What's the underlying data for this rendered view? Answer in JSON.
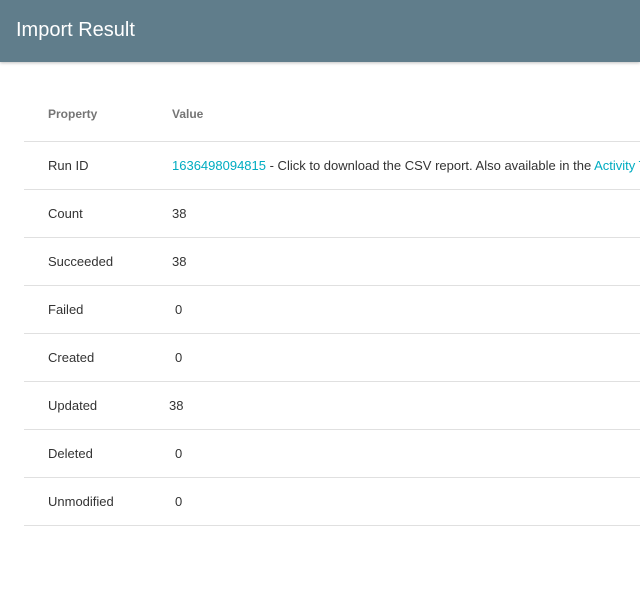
{
  "header": {
    "title": "Import Result"
  },
  "table": {
    "columns": {
      "property": "Property",
      "value": "Value"
    },
    "run": {
      "label": "Run ID",
      "id_link": "1636498094815",
      "description": " - Click to download the CSV report. Also available in the ",
      "activity_link": "Activity T"
    },
    "rows": [
      {
        "property": "Count",
        "value": "38"
      },
      {
        "property": "Succeeded",
        "value": "38"
      },
      {
        "property": "Failed",
        "value": "0"
      },
      {
        "property": "Created",
        "value": "0"
      },
      {
        "property": "Updated",
        "value": "38"
      },
      {
        "property": "Deleted",
        "value": "0"
      },
      {
        "property": "Unmodified",
        "value": "0"
      }
    ]
  },
  "colors": {
    "header_bg": "#607d8b",
    "link": "#00acc1",
    "divider": "#e0e0e0"
  }
}
